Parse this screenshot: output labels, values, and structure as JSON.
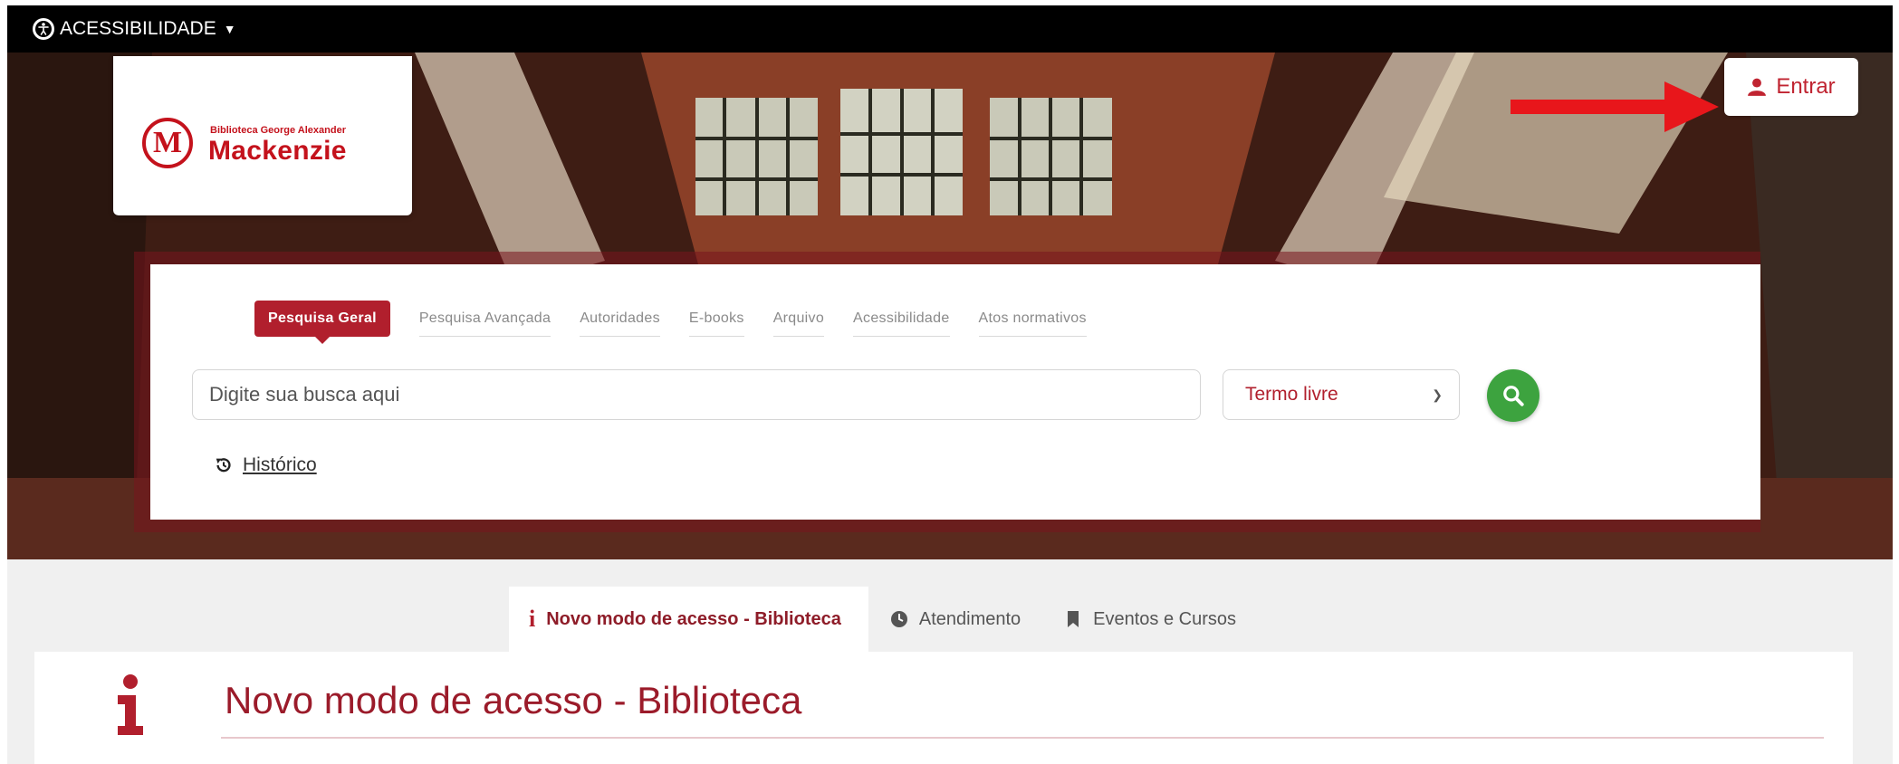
{
  "topbar": {
    "accessibility_label": "ACESSIBILIDADE"
  },
  "logo": {
    "small_text": "Biblioteca George Alexander",
    "big_text": "Mackenzie",
    "mark": "M"
  },
  "login": {
    "label": "Entrar"
  },
  "search": {
    "tabs": [
      {
        "label": "Pesquisa Geral",
        "active": true
      },
      {
        "label": "Pesquisa Avançada"
      },
      {
        "label": "Autoridades"
      },
      {
        "label": "E-books"
      },
      {
        "label": "Arquivo"
      },
      {
        "label": "Acessibilidade"
      },
      {
        "label": "Atos normativos"
      }
    ],
    "placeholder": "Digite sua busca aqui",
    "select_value": "Termo livre",
    "history_label": "Histórico"
  },
  "content": {
    "tabs": [
      {
        "label": "Novo modo de acesso - Biblioteca",
        "active": true,
        "icon": "info-icon"
      },
      {
        "label": "Atendimento",
        "icon": "clock-icon"
      },
      {
        "label": "Eventos e Cursos",
        "icon": "bookmark-icon"
      }
    ],
    "title": "Novo modo de acesso - Biblioteca"
  },
  "colors": {
    "brand_red": "#b11f2d",
    "search_green": "#3da33f",
    "topbar": "#000000"
  }
}
